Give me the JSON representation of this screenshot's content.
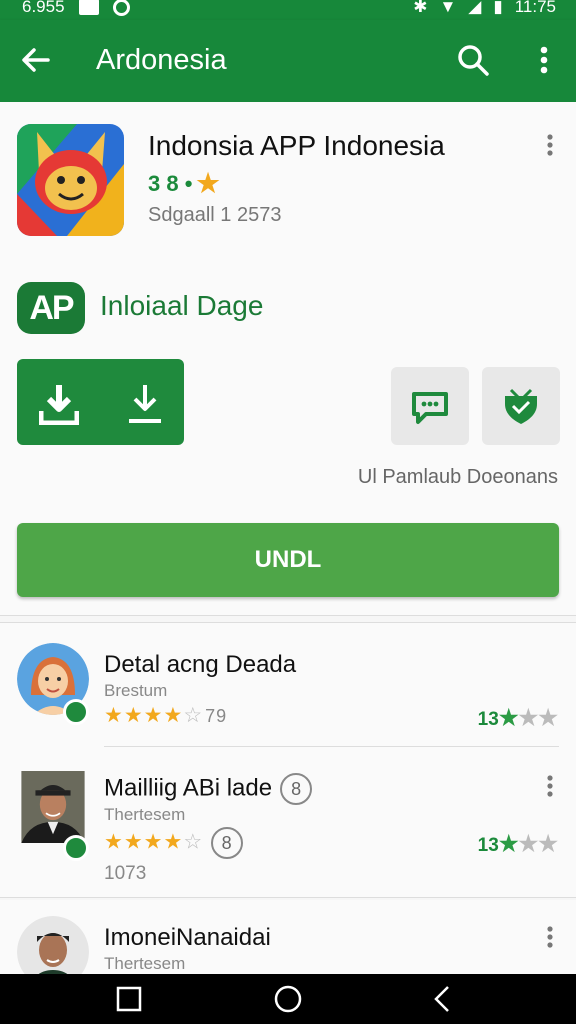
{
  "status_bar": {
    "time_left": "6.955",
    "time_right": "11:75"
  },
  "toolbar": {
    "title": "Ardonesia"
  },
  "app": {
    "name": "Indonsia APP Indonesia",
    "rating": "3 8 •",
    "meta": "Sdgaall 1 2573"
  },
  "developer": {
    "logo_text": "AP",
    "name": "Inloiaal Dage"
  },
  "install_note": "Ul Pamlaub Doeonans",
  "install_button": "UNDL",
  "reviews": [
    {
      "name": "Detal acng Deada",
      "subtitle": "Brestum",
      "stars_count": "79",
      "score": "13"
    },
    {
      "name": "Mailliig ABi lade",
      "badge": "8",
      "subtitle": "Thertesem",
      "badge2": "8",
      "score": "13",
      "extra": "1073"
    },
    {
      "name": "ImoneiNanaidai",
      "subtitle": "Thertesem"
    }
  ],
  "colors": {
    "primary": "#17883a",
    "accent": "#4ea648",
    "star": "#f2a81d"
  }
}
